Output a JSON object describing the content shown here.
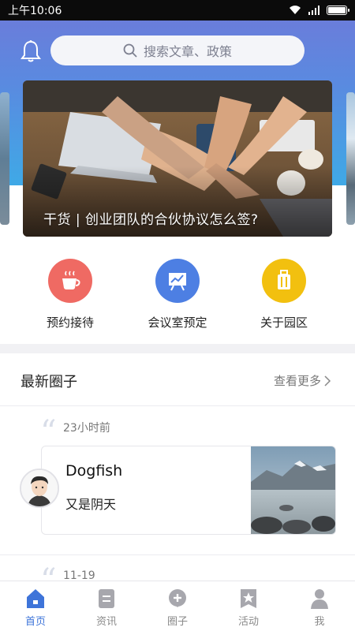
{
  "status_bar": {
    "time": "上午10:06"
  },
  "search": {
    "placeholder": "搜索文章、政策"
  },
  "banner": {
    "caption": "干货 | 创业团队的合伙协议怎么签?"
  },
  "quick_actions": [
    {
      "label": "预约接待",
      "icon": "coffee-cup-icon",
      "color": "#ef6a63"
    },
    {
      "label": "会议室预定",
      "icon": "presentation-board-icon",
      "color": "#4d7fe3"
    },
    {
      "label": "关于园区",
      "icon": "luggage-icon",
      "color": "#f2c00f"
    }
  ],
  "circle_section": {
    "title": "最新圈子",
    "more_label": "查看更多"
  },
  "posts": [
    {
      "time": "23小时前",
      "author": "Dogfish",
      "text": "又是阴天"
    },
    {
      "time": "11-19"
    }
  ],
  "bottom_nav": [
    {
      "label": "首页",
      "icon": "home-icon",
      "active": true
    },
    {
      "label": "资讯",
      "icon": "news-icon",
      "active": false
    },
    {
      "label": "圈子",
      "icon": "circle-icon",
      "active": false
    },
    {
      "label": "活动",
      "icon": "event-star-icon",
      "active": false
    },
    {
      "label": "我",
      "icon": "person-icon",
      "active": false
    }
  ],
  "colors": {
    "accent": "#3e74d9",
    "header_top": "#6f79d9",
    "header_bottom": "#3fa9e6"
  }
}
